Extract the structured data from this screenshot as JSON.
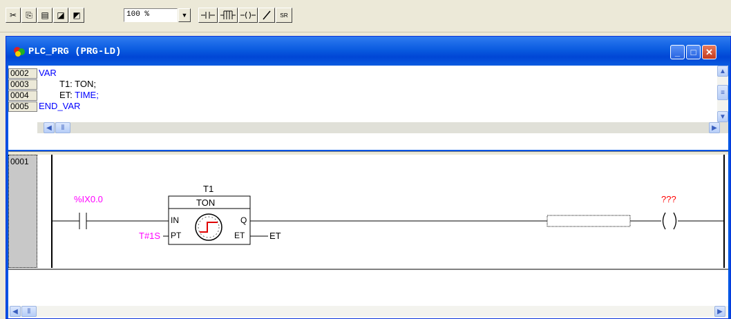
{
  "toolbar": {
    "buttons": [
      {
        "icon": "cut-icon",
        "glyph": "✂"
      },
      {
        "icon": "copy-icon",
        "glyph": "⎘"
      },
      {
        "icon": "paste-icon",
        "glyph": "📋"
      },
      {
        "icon": "find-icon",
        "glyph": "🔍"
      },
      {
        "icon": "find-next-icon",
        "glyph": "🔎"
      }
    ],
    "zoom_value": "100 %",
    "ld_buttons": [
      {
        "icon": "contact-icon",
        "glyph": "⊣⊢"
      },
      {
        "icon": "parallel-contact-icon",
        "glyph": "⊣⊢"
      },
      {
        "icon": "coil-icon",
        "glyph": "-( )-"
      },
      {
        "icon": "negate-icon",
        "glyph": "/"
      },
      {
        "icon": "set-reset-icon",
        "glyph": "SR"
      }
    ]
  },
  "window": {
    "title": "PLC_PRG  (PRG-LD)"
  },
  "declaration": {
    "lines": [
      {
        "no": "0002",
        "kw": "VAR",
        "text": ""
      },
      {
        "no": "0003",
        "kw": "",
        "text": "T1: TON;"
      },
      {
        "no": "0004",
        "kw": "TIME;",
        "text": "ET: "
      },
      {
        "no": "0005",
        "kw": "END_VAR",
        "text": ""
      }
    ]
  },
  "network": {
    "number": "0001",
    "contact_label": "%IX0.0",
    "timer_instance": "T1",
    "timer_type": "TON",
    "pin_in": "IN",
    "pin_pt": "PT",
    "pin_q": "Q",
    "pin_et": "ET",
    "pt_value": "T#1S",
    "et_output": "ET",
    "coil_label": "???",
    "coil_symbol": "( )"
  },
  "colors": {
    "magenta": "#ff00ff",
    "red": "#ff0000",
    "keyword_blue": "#0000ff",
    "title_blue": "#0a5be0"
  }
}
